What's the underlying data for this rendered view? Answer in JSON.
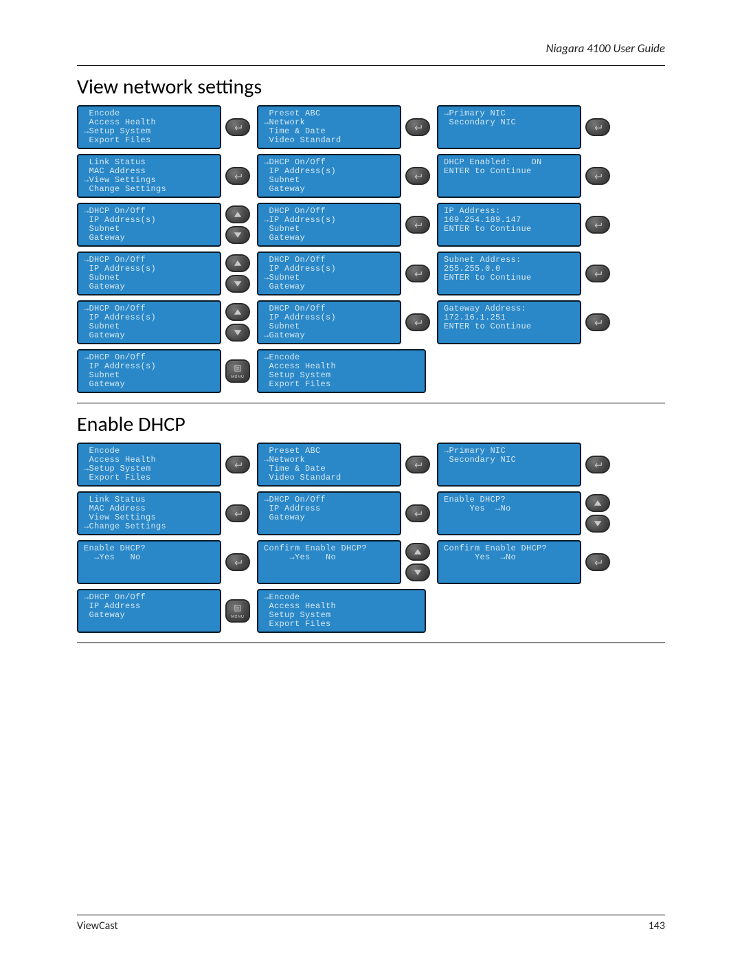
{
  "doc_title": "Niagara 4100 User Guide",
  "footer_left": "ViewCast",
  "footer_right": "143",
  "section1": "View network settings",
  "section2": "Enable DHCP",
  "icons": {
    "enter": "↵",
    "up": "▲",
    "down": "▼",
    "menu": "MENU"
  },
  "grids": {
    "view": [
      [
        {
          "lines": [
            " Encode",
            " Access Health",
            "→Setup System",
            " Export Files"
          ],
          "btns": [
            "enter"
          ]
        },
        {
          "lines": [
            " Preset ABC",
            "→Network",
            " Time & Date",
            " Video Standard"
          ],
          "btns": [
            "enter"
          ]
        },
        {
          "lines": [
            "→Primary NIC",
            " Secondary NIC"
          ],
          "btns": [
            "enter"
          ]
        }
      ],
      [
        {
          "lines": [
            " Link Status",
            " MAC Address",
            "→View Settings",
            " Change Settings"
          ],
          "btns": [
            "enter"
          ]
        },
        {
          "lines": [
            "→DHCP On/Off",
            " IP Address(s)",
            " Subnet",
            " Gateway"
          ],
          "btns": [
            "enter"
          ]
        },
        {
          "lines": [
            "DHCP Enabled:    ON",
            "",
            "",
            "ENTER to Continue"
          ],
          "btns": [
            "enter"
          ]
        }
      ],
      [
        {
          "lines": [
            "→DHCP On/Off",
            " IP Address(s)",
            " Subnet",
            " Gateway"
          ],
          "btns": [
            "up",
            "down"
          ]
        },
        {
          "lines": [
            " DHCP On/Off",
            "→IP Address(s)",
            " Subnet",
            " Gateway"
          ],
          "btns": [
            "enter"
          ]
        },
        {
          "lines": [
            "IP Address:",
            "169.254.189.147",
            "",
            "ENTER to Continue"
          ],
          "btns": [
            "enter"
          ]
        }
      ],
      [
        {
          "lines": [
            "→DHCP On/Off",
            " IP Address(s)",
            " Subnet",
            " Gateway"
          ],
          "btns": [
            "up",
            "down"
          ]
        },
        {
          "lines": [
            " DHCP On/Off",
            " IP Address(s)",
            "→Subnet",
            " Gateway"
          ],
          "btns": [
            "enter"
          ]
        },
        {
          "lines": [
            "Subnet Address:",
            "255.255.0.0",
            "",
            "ENTER to Continue"
          ],
          "btns": [
            "enter"
          ]
        }
      ],
      [
        {
          "lines": [
            "→DHCP On/Off",
            " IP Address(s)",
            " Subnet",
            " Gateway"
          ],
          "btns": [
            "up",
            "down"
          ]
        },
        {
          "lines": [
            " DHCP On/Off",
            " IP Address(s)",
            " Subnet",
            "→Gateway"
          ],
          "btns": [
            "enter"
          ]
        },
        {
          "lines": [
            "Gateway Address:",
            "172.16.1.251",
            "",
            "ENTER to Continue"
          ],
          "btns": [
            "enter"
          ]
        }
      ],
      [
        {
          "lines": [
            "→DHCP On/Off",
            " IP Address(s)",
            " Subnet",
            " Gateway"
          ],
          "btns": [
            "menu"
          ]
        },
        {
          "lines": [
            "→Encode",
            " Access Health",
            " Setup System",
            " Export Files"
          ],
          "btns": []
        },
        null
      ]
    ],
    "dhcp": [
      [
        {
          "lines": [
            " Encode",
            " Access Health",
            "→Setup System",
            " Export Files"
          ],
          "btns": [
            "enter"
          ]
        },
        {
          "lines": [
            " Preset ABC",
            "→Network",
            " Time & Date",
            " Video Standard"
          ],
          "btns": [
            "enter"
          ]
        },
        {
          "lines": [
            "→Primary NIC",
            " Secondary NIC"
          ],
          "btns": [
            "enter"
          ]
        }
      ],
      [
        {
          "lines": [
            " Link Status",
            " MAC Address",
            " View Settings",
            "→Change Settings"
          ],
          "btns": [
            "enter"
          ]
        },
        {
          "lines": [
            "→DHCP On/Off",
            " IP Address",
            " Gateway"
          ],
          "btns": [
            "enter"
          ]
        },
        {
          "lines": [
            "Enable DHCP?",
            "",
            "",
            "     Yes  →No"
          ],
          "btns": [
            "up",
            "down"
          ]
        }
      ],
      [
        {
          "lines": [
            "Enable DHCP?",
            "",
            "",
            "  →Yes   No"
          ],
          "btns": [
            "enter"
          ]
        },
        {
          "lines": [
            "Confirm Enable DHCP?",
            "",
            "",
            "     →Yes   No"
          ],
          "btns": [
            "up",
            "down"
          ]
        },
        {
          "lines": [
            "Confirm Enable DHCP?",
            "",
            "",
            "      Yes  →No"
          ],
          "btns": [
            "enter"
          ]
        }
      ],
      [
        {
          "lines": [
            "→DHCP On/Off",
            " IP Address",
            " Gateway"
          ],
          "btns": [
            "menu"
          ]
        },
        {
          "lines": [
            "→Encode",
            " Access Health",
            " Setup System",
            " Export Files"
          ],
          "btns": []
        },
        null
      ]
    ]
  }
}
